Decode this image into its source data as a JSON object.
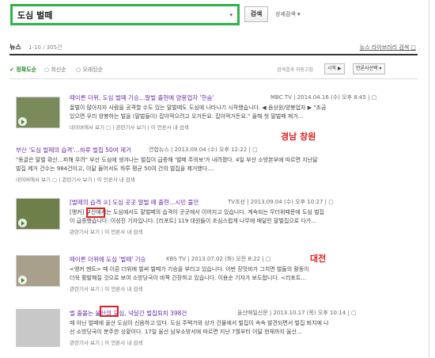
{
  "search": {
    "query": "도심 벌떼",
    "dropdown": "▾",
    "button": "검색",
    "detail": "상세검색 ▾"
  },
  "tabbar": {
    "title": "뉴스",
    "count": "1-10 / 305건",
    "library_link": "뉴스 라이브러리 검색 ▢"
  },
  "filters": {
    "items": [
      "✔ 정확도순",
      "○ 최신순",
      "○ 오래된순"
    ],
    "lab_label": "검색결과 자동고침",
    "start_btn": "시작 ▶",
    "press_btn": "언론사선택 ▾"
  },
  "results": [
    {
      "title": "때이른 더위, 도심 벌떼 기승…말벌 출현에 양봉업자 '한숨'",
      "meta": "MBC TV  |  2014.04.16 (수) 오후 8:45  |  ▢",
      "desc1": "꿀벌이 많아지자 사람을 공격할 수도 있는 말벌떼도 도심에 나타나기 시작했습니다. ◀ 음상원/양봉업자 ▶ \"조금",
      "desc2": "있으면 우리 양봉하는 벌을 (말벌들이) 잡아먹으려고 오거든요. 잡아먹거든요.\" 올해 첫 말벌떼 제거...",
      "links": "네이버에서 보기 ▢  |  관련기사 보기  |  이 언론사 내 검색"
    },
    {
      "title": "부산 '도심 벌떼의 습격'…하루 벌집 50여 제거",
      "meta": "연합뉴스  |  2013.09.04 (수) 오후 12:22  |  ▢",
      "desc1": "\"동굴은 말벌 확산…피해 우려\" 부산 도심에 생겨나는 벌집이 급증해 '벌떼 주의보'가 내려졌다. 4일 부산 소방본부에 따르면 지난달",
      "desc2": "벌집 제거 건수는 984건이고, 이달 들어서도 하루 평균 50여 건의 벌집을 제거했다....",
      "links": "네이버에서 보기 ▢  |  관련기사 보기  |  이 언론사 내 검색"
    },
    {
      "title": "[벌떼의 습격 ②] 도심 곳곳 말벌 떼 출현…시민 불안",
      "meta": "TV조선  |  2013.09.04 (수) 오후 10:27  |  ▢",
      "desc1": "[앵커] 부산에서는 도심에서도 말벌떼의 습격이 곳곳에서 이어지고 있습니다. 계속되는 무더위때문에 도심 벌집",
      "desc2": "이 급증했습니다. 이성진 기자입니다. [리포트] 119 대원들이 조심스럽게 나무에 매달린 말벌집으로 다가...",
      "links": "관련기사 보기  |  이 언론사 내 검색"
    },
    {
      "title": "때이른 더위에 도심 '벌떼' 기승",
      "meta": "KBS TV  |  2013.07.02 (화) 오전 8:22  |  ▢",
      "desc1": "<앵커 멘트> 때 이른 더위에 벌써 벌떼가 기승을 부리고 있습니다. 이번 장맛비가 그치면 벌들의 활동이",
      "desc2": "더욱 활발해질 것으로 보여 소방당국이 바짝 긴장하고 있습니다. 이용순 기자가 보도합니다. <리포트...",
      "links": "관련기사 보기  |  이 언론사 내 검색"
    },
    {
      "title": "벌 출몰는 울산의 도심, 넉달간 벌집퇴치 398건",
      "meta": "울산매일신문  |  2013.10.17 (목) 오후 10:14  |  ▢",
      "desc1": "때 아닌 벌떼에 울산 도심이 신음하고 있다. 도심 주택가와 상가 건물에서 벌집이 속속 발견되면서 벌집 퇴치에 나",
      "desc2": "선 소방당국이 분주한 상황이다. 17일 울산 남부소방서에 따르면 지난 7월부터 이달 현재까지 울산...",
      "links": "관련기사 보기  |  이 언론사 내 검색"
    }
  ],
  "annotations": {
    "changwon": "경남 창원",
    "daejeon": "대전"
  }
}
